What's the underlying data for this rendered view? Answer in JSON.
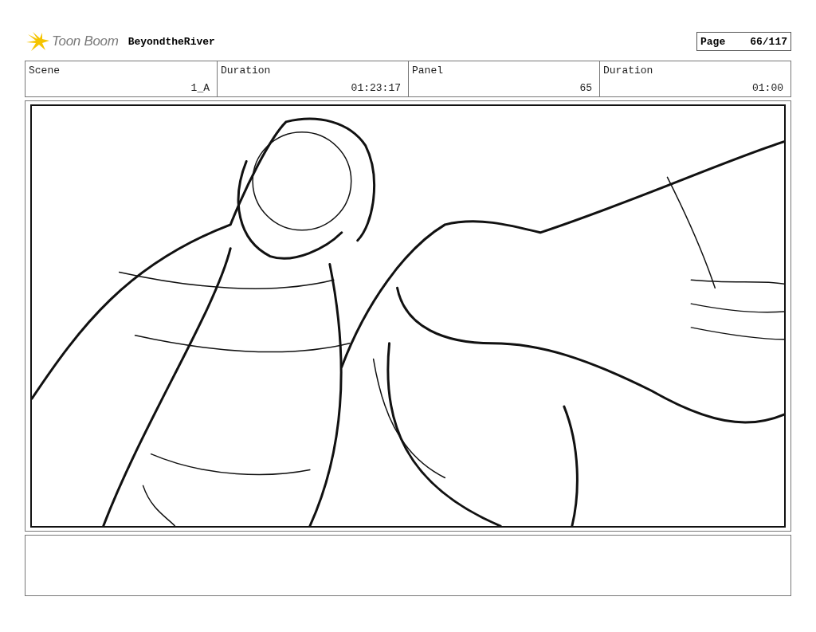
{
  "header": {
    "logo_text": "Toon Boom",
    "project_title": "BeyondtheRiver",
    "page_label": "Page",
    "page_number": "66/117"
  },
  "info_fields": [
    {
      "label": "Scene",
      "value": "1_A"
    },
    {
      "label": "Duration",
      "value": "01:23:17"
    },
    {
      "label": "Panel",
      "value": "65"
    },
    {
      "label": "Duration",
      "value": "01:00"
    }
  ]
}
